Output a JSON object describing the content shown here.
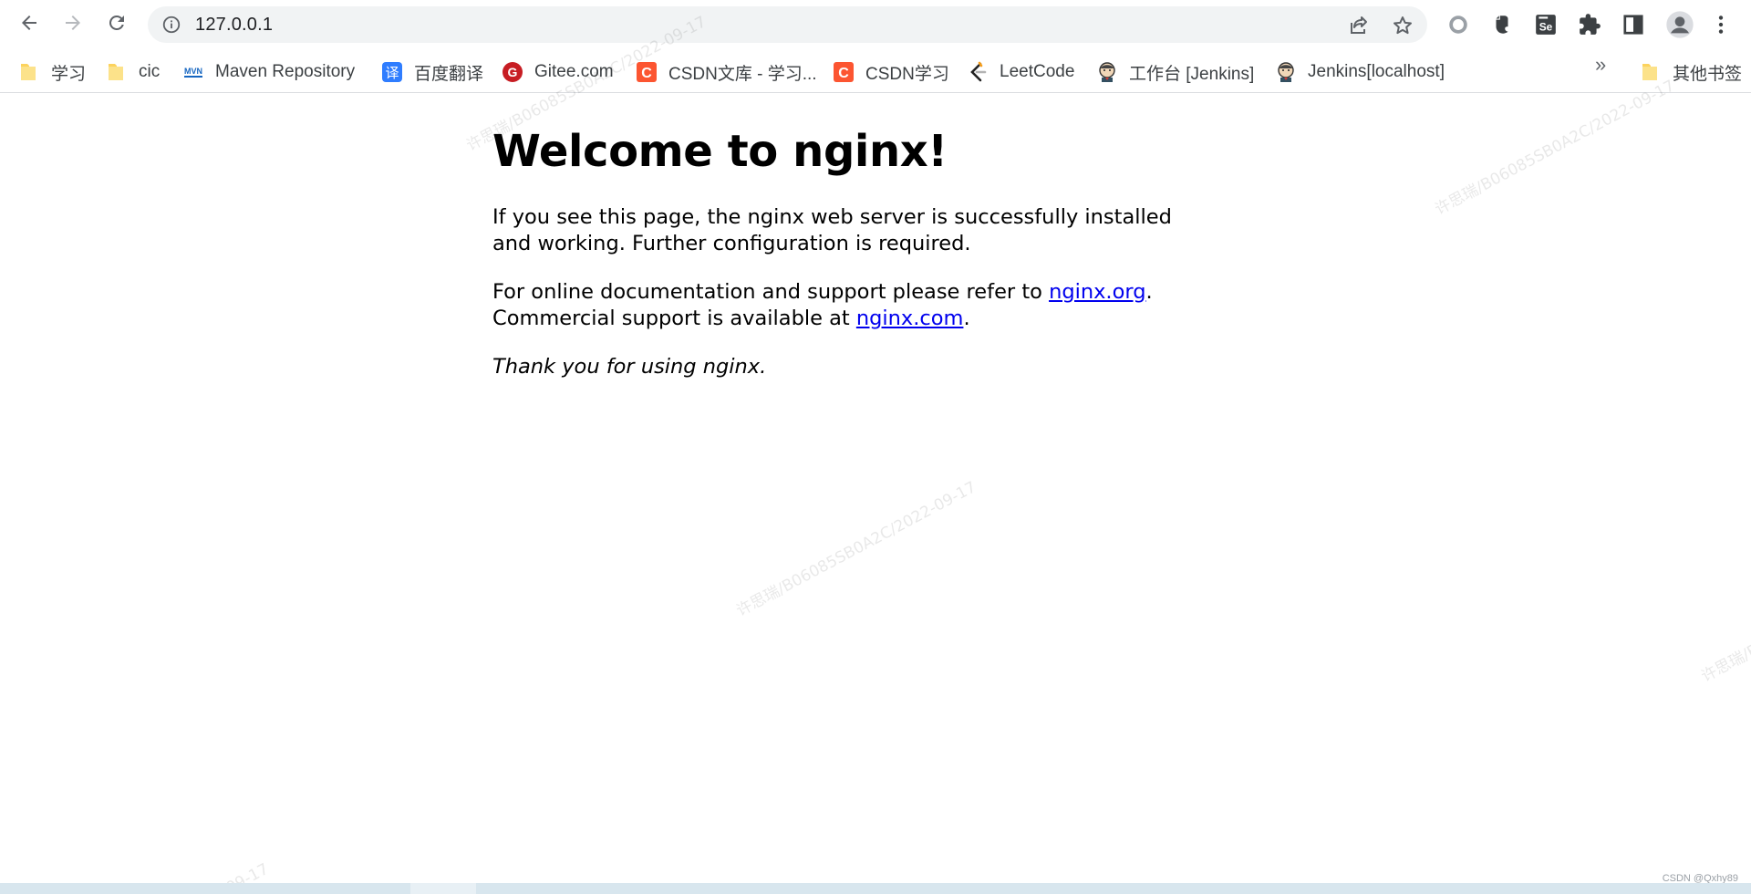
{
  "browser": {
    "url": "127.0.0.1",
    "nav": [
      "arrow-left-icon",
      "arrow-right-icon",
      "reload-icon"
    ],
    "omnibox_icons": [
      "info-icon",
      "share-icon",
      "star-icon"
    ],
    "extensions": [
      "circle-extension-icon",
      "evernote-icon",
      "selenium-icon",
      "puzzle-icon",
      "sidepanel-icon",
      "profile-icon",
      "menu-icon"
    ],
    "selenium_label": "Se"
  },
  "bookmarks": {
    "items": [
      {
        "label": "学习",
        "icon": "folder-icon"
      },
      {
        "label": "cic",
        "icon": "folder-icon"
      },
      {
        "label": "Maven Repository",
        "icon": "maven-icon"
      },
      {
        "label": "百度翻译",
        "icon": "baidu-translate-icon"
      },
      {
        "label": "Gitee.com",
        "icon": "gitee-icon"
      },
      {
        "label": "CSDN文库 - 学习...",
        "icon": "csdn-icon"
      },
      {
        "label": "CSDN学习",
        "icon": "csdn-icon"
      },
      {
        "label": "LeetCode",
        "icon": "leetcode-icon"
      },
      {
        "label": "工作台 [Jenkins]",
        "icon": "jenkins-icon"
      },
      {
        "label": "Jenkins[localhost]",
        "icon": "jenkins-icon"
      }
    ],
    "overflow": "»",
    "other": "其他书签",
    "icon_text": {
      "maven": "MVN",
      "translate": "译",
      "gitee": "G",
      "csdn": "C"
    }
  },
  "page": {
    "heading": "Welcome to nginx!",
    "para1": "If you see this page, the nginx web server is successfully installed and working. Further configuration is required.",
    "para2_prefix": "For online documentation and support please refer to ",
    "link1": "nginx.org",
    "para2_middle": ".",
    "para2_line2": "Commercial support is available at ",
    "link2": "nginx.com",
    "para2_end": ".",
    "thanks": "Thank you for using nginx."
  },
  "watermark": {
    "text": "许思瑞/B06085SB0A2C/2022-09-17",
    "fragment": "2-09-17"
  },
  "footer": {
    "credit": "CSDN @Qxhy89"
  },
  "colors": {
    "link": "#0000ee",
    "omnibox_bg": "#f1f3f4",
    "csdn": "#fc5531",
    "gitee": "#c71d23",
    "folder": "#fcd35e",
    "translate": "#2f7dff"
  }
}
